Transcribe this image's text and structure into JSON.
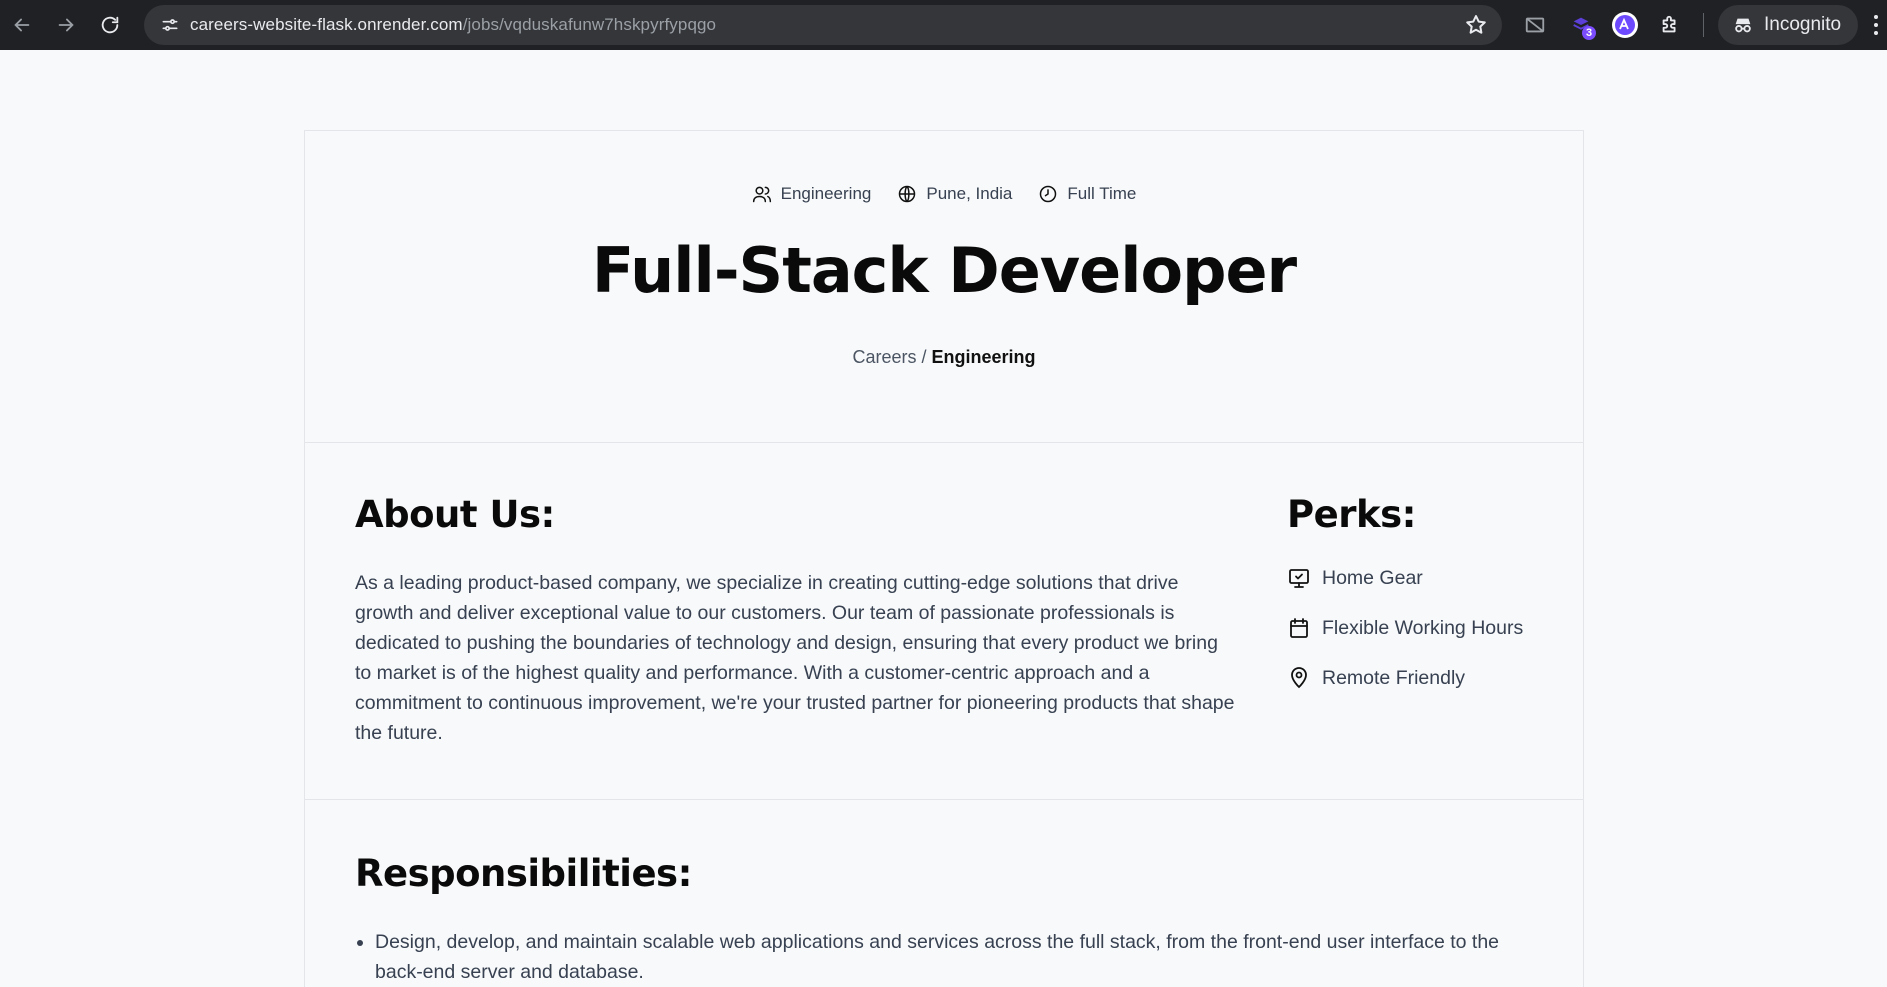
{
  "browser": {
    "url_host": "careers-website-flask.onrender.com",
    "url_path": "/jobs/vqduskafunw7hskpyrfypqgo",
    "extension_badge": "3",
    "incognito_label": "Incognito"
  },
  "job": {
    "meta": {
      "department": "Engineering",
      "location": "Pune, India",
      "type": "Full Time"
    },
    "title": "Full-Stack Developer",
    "breadcrumb": {
      "root": "Careers",
      "separator": "/",
      "current": "Engineering"
    }
  },
  "about": {
    "heading": "About Us:",
    "body": "As a leading product-based company, we specialize in creating cutting-edge solutions that drive growth and deliver exceptional value to our customers. Our team of passionate professionals is dedicated to pushing the boundaries of technology and design, ensuring that every product we bring to market is of the highest quality and performance. With a customer-centric approach and a commitment to continuous improvement, we're your trusted partner for pioneering products that shape the future."
  },
  "perks": {
    "heading": "Perks:",
    "items": [
      {
        "label": "Home Gear",
        "icon": "monitor-check-icon"
      },
      {
        "label": "Flexible Working Hours",
        "icon": "calendar-icon"
      },
      {
        "label": "Remote Friendly",
        "icon": "map-pin-icon"
      }
    ]
  },
  "responsibilities": {
    "heading": "Responsibilities:",
    "items": [
      "Design, develop, and maintain scalable web applications and services across the full stack, from the front-end user interface to the back-end server and database."
    ]
  }
}
